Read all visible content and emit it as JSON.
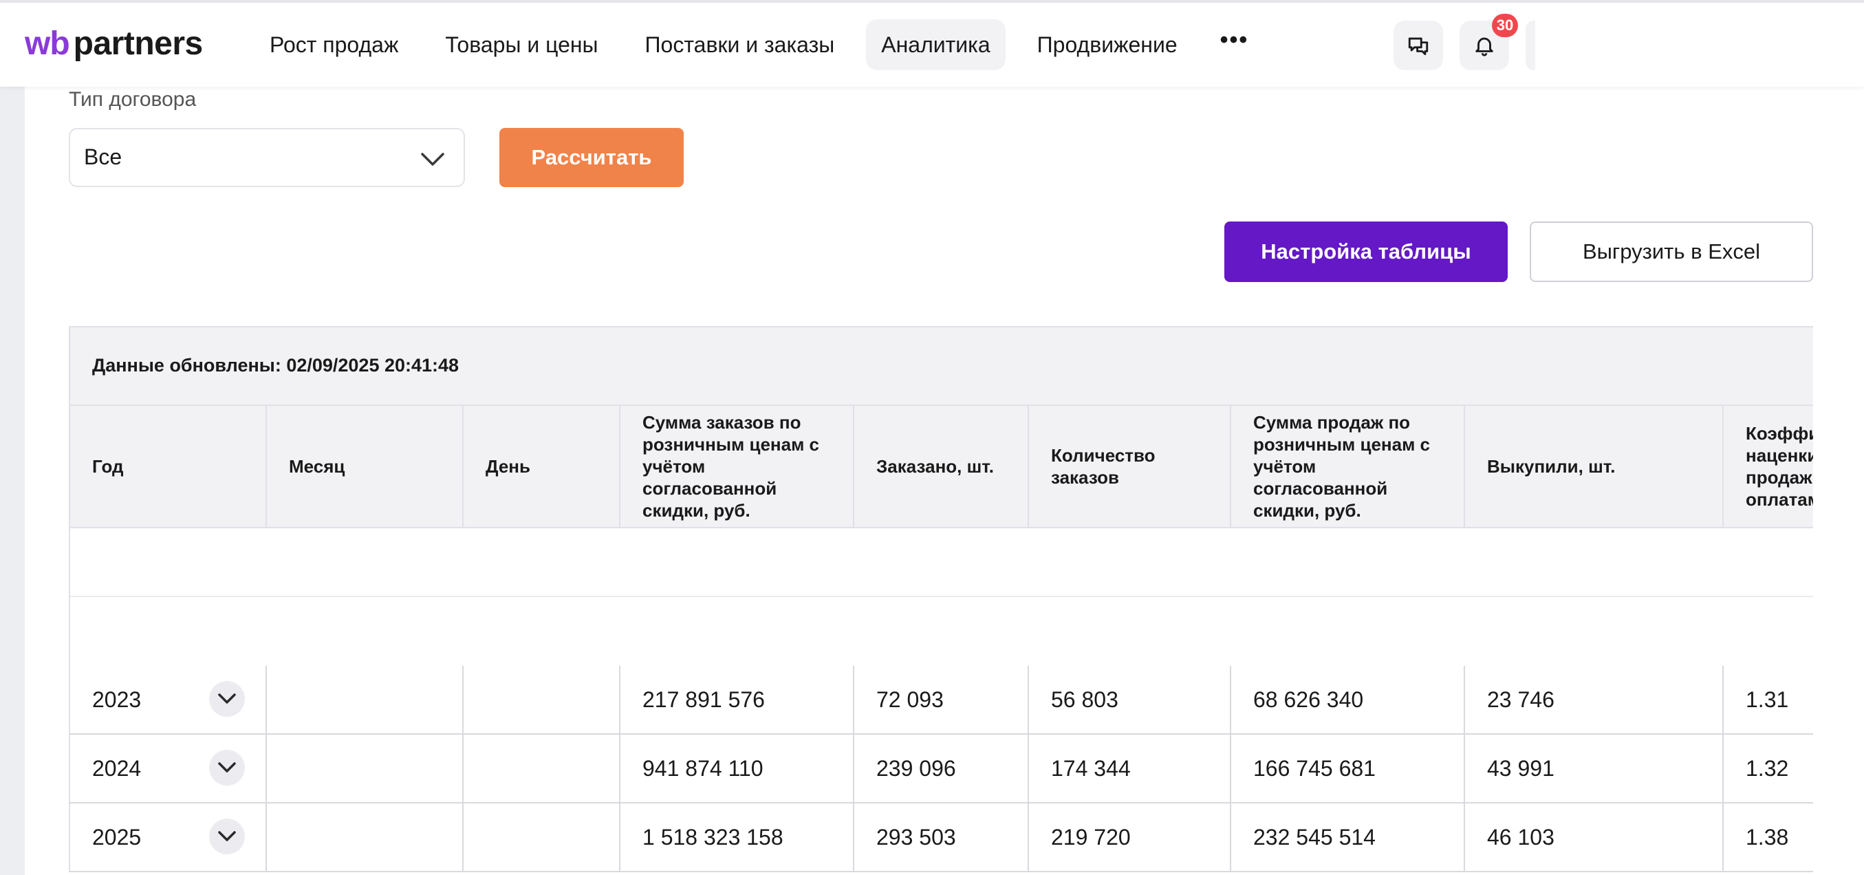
{
  "header": {
    "logo_wb": "wb",
    "logo_partners": "partners",
    "nav": [
      "Рост продаж",
      "Товары и цены",
      "Поставки и заказы",
      "Аналитика",
      "Продвижение"
    ],
    "nav_active": "Аналитика",
    "more": "•••",
    "notifications_count": "30",
    "icons": [
      "chat-icon",
      "bell-icon"
    ]
  },
  "filters": {
    "contract_type_label": "Тип договора",
    "contract_type_value": "Все",
    "calculate_button": "Рассчитать"
  },
  "toolbar": {
    "settings_button": "Настройка таблицы",
    "export_button": "Выгрузить в Excel"
  },
  "table": {
    "updated": "Данные обновлены: 02/09/2025 20:41:48",
    "columns": [
      "Год",
      "Месяц",
      "День",
      "Сумма заказов по розничным ценам с учётом согласованной скидки, руб.",
      "Заказано, шт.",
      "Количество заказов",
      "Сумма продаж по розничным ценам с учётом согласованной скидки, руб.",
      "Выкупили, шт.",
      "Коэффициент наценки продаж к оплатам"
    ],
    "rows": [
      {
        "year": "2023",
        "month": "",
        "day": "",
        "orders_sum": "217 891 576",
        "ordered": "72 093",
        "orders_count": "56 803",
        "sales_sum": "68 626 340",
        "bought": "23 746",
        "coef": "1.31"
      },
      {
        "year": "2024",
        "month": "",
        "day": "",
        "orders_sum": "941 874 110",
        "ordered": "239 096",
        "orders_count": "174 344",
        "sales_sum": "166 745 681",
        "bought": "43 991",
        "coef": "1.32"
      },
      {
        "year": "2025",
        "month": "",
        "day": "",
        "orders_sum": "1 518 323 158",
        "ordered": "293 503",
        "orders_count": "219 720",
        "sales_sum": "232 545 514",
        "bought": "46 103",
        "coef": "1.38"
      }
    ]
  },
  "colors": {
    "accent_purple": "#6418c6",
    "accent_orange": "#f0834a",
    "badge_red": "#f0474f"
  }
}
